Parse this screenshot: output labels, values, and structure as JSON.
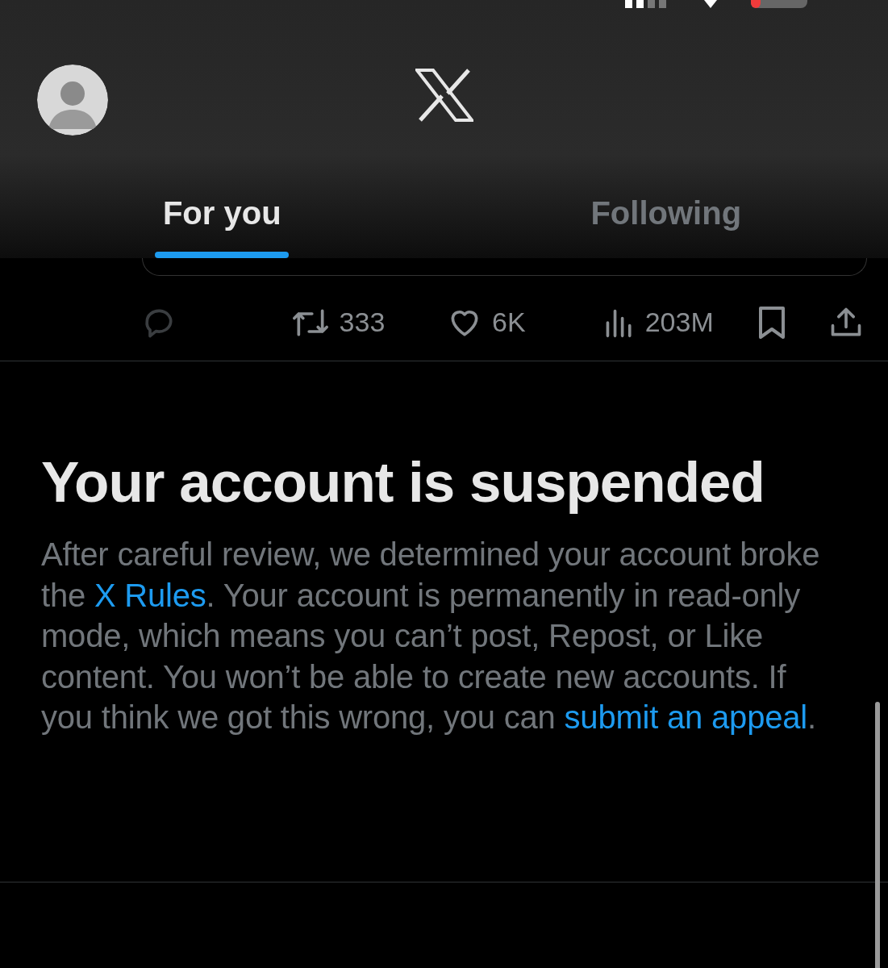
{
  "header": {
    "tabs": [
      {
        "label": "For you",
        "selected": true
      },
      {
        "label": "Following",
        "selected": false
      }
    ]
  },
  "actions": [
    {
      "kind": "reply",
      "disabled": true
    },
    {
      "kind": "repost",
      "count": "333",
      "disabled": false
    },
    {
      "kind": "like",
      "count": "6K",
      "disabled": false
    },
    {
      "kind": "views",
      "count": "203M",
      "disabled": false
    },
    {
      "kind": "bookmark",
      "disabled": false
    },
    {
      "kind": "share",
      "disabled": false
    }
  ],
  "notice": {
    "title": "Your account is suspended",
    "body": [
      {
        "kind": "text",
        "text": "After careful review, we determined your account broke the "
      },
      {
        "kind": "link",
        "text": "X Rules"
      },
      {
        "kind": "text",
        "text": ". Your account is permanently in read-only mode, which means you can’t post, Repost, or Like content. You won’t be able to create new accounts. If you think we got this wrong, you can "
      },
      {
        "kind": "link",
        "text": "submit an appeal"
      },
      {
        "kind": "text",
        "text": "."
      }
    ]
  }
}
